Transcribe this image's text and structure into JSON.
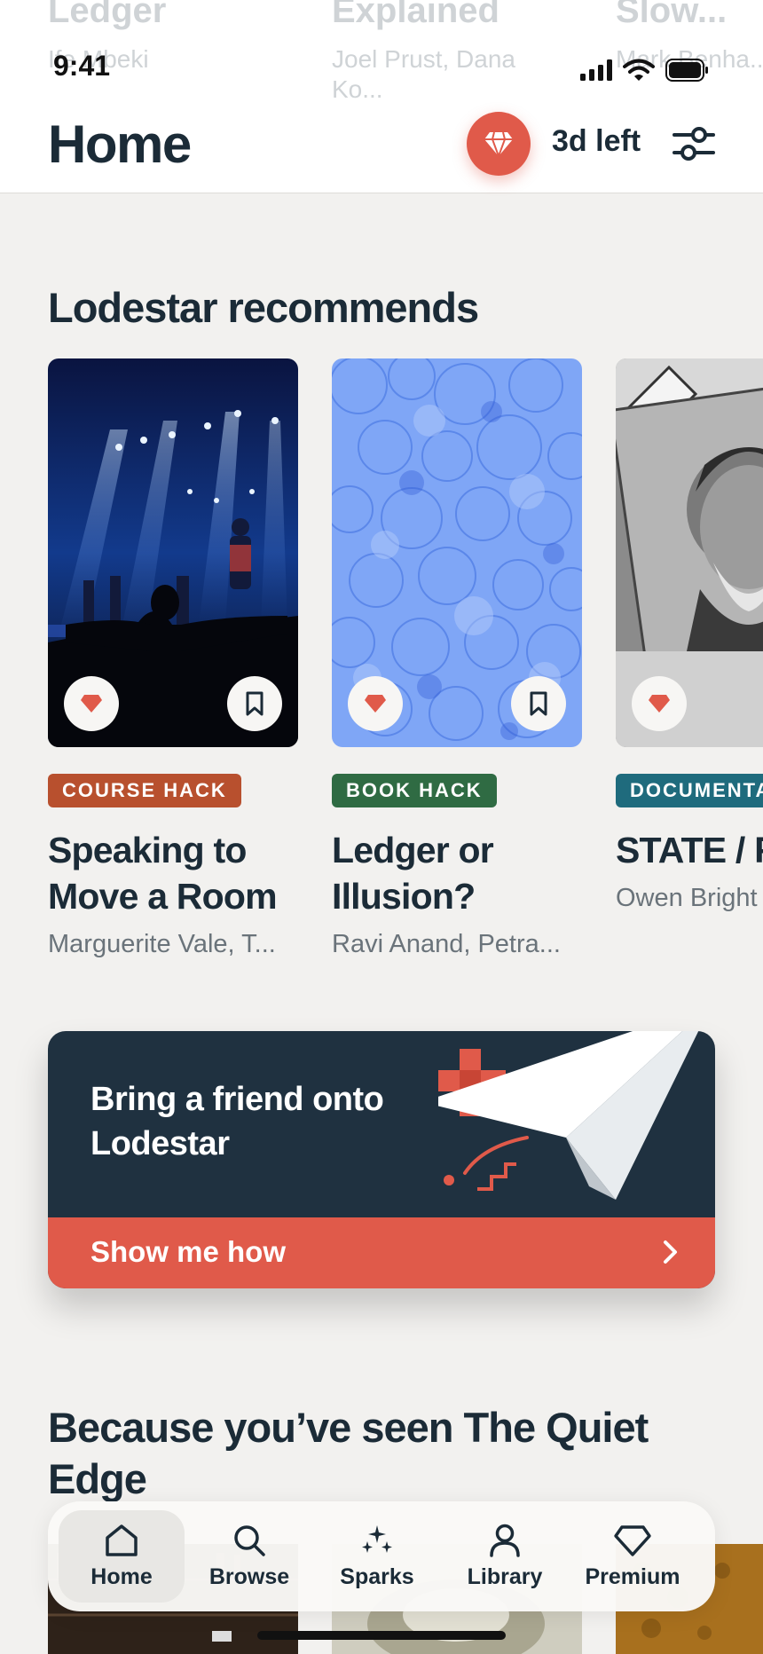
{
  "ghost_row": [
    {
      "title": "Ledger",
      "authors": "Ife Mbeki"
    },
    {
      "title": "Explained",
      "authors": "Joel Prust, Dana Ko..."
    },
    {
      "title": "Slow...",
      "authors": "Mark Benha..."
    }
  ],
  "status_bar": {
    "time": "9:41"
  },
  "header": {
    "title": "Home",
    "trial_days": "3d left"
  },
  "recommends": {
    "title": "Lodestar recommends",
    "cards": [
      {
        "tag": "COURSE HACK",
        "tag_color": "#b8502e",
        "title_line1": "Speaking to",
        "title_line2": "Move a Room",
        "authors": "Marguerite Vale, T..."
      },
      {
        "tag": "BOOK HACK",
        "tag_color": "#2f6b43",
        "title_line1": "Ledger or",
        "title_line2": "Illusion?",
        "authors": "Ravi Anand, Petra..."
      },
      {
        "tag": "DOCUMENTA",
        "tag_color": "#1f6b7d",
        "title_line1": "STATE / F",
        "title_line2": "",
        "authors": "Owen Bright"
      }
    ]
  },
  "promo": {
    "text": "Bring a friend onto Lodestar",
    "cta": "Show me how"
  },
  "because": {
    "title": "Because you’ve seen The Quiet Edge"
  },
  "tabbar": {
    "tabs": [
      {
        "label": "Home",
        "icon": "home-icon",
        "active": true
      },
      {
        "label": "Browse",
        "icon": "search-icon",
        "active": false
      },
      {
        "label": "Sparks",
        "icon": "sparkles-icon",
        "active": false
      },
      {
        "label": "Library",
        "icon": "person-icon",
        "active": false
      },
      {
        "label": "Premium",
        "icon": "diamond-icon",
        "active": false
      }
    ]
  },
  "colors": {
    "accent": "#e05a4a",
    "navy": "#1f3140",
    "text": "#1b2b37",
    "background": "#f2f1ef"
  }
}
